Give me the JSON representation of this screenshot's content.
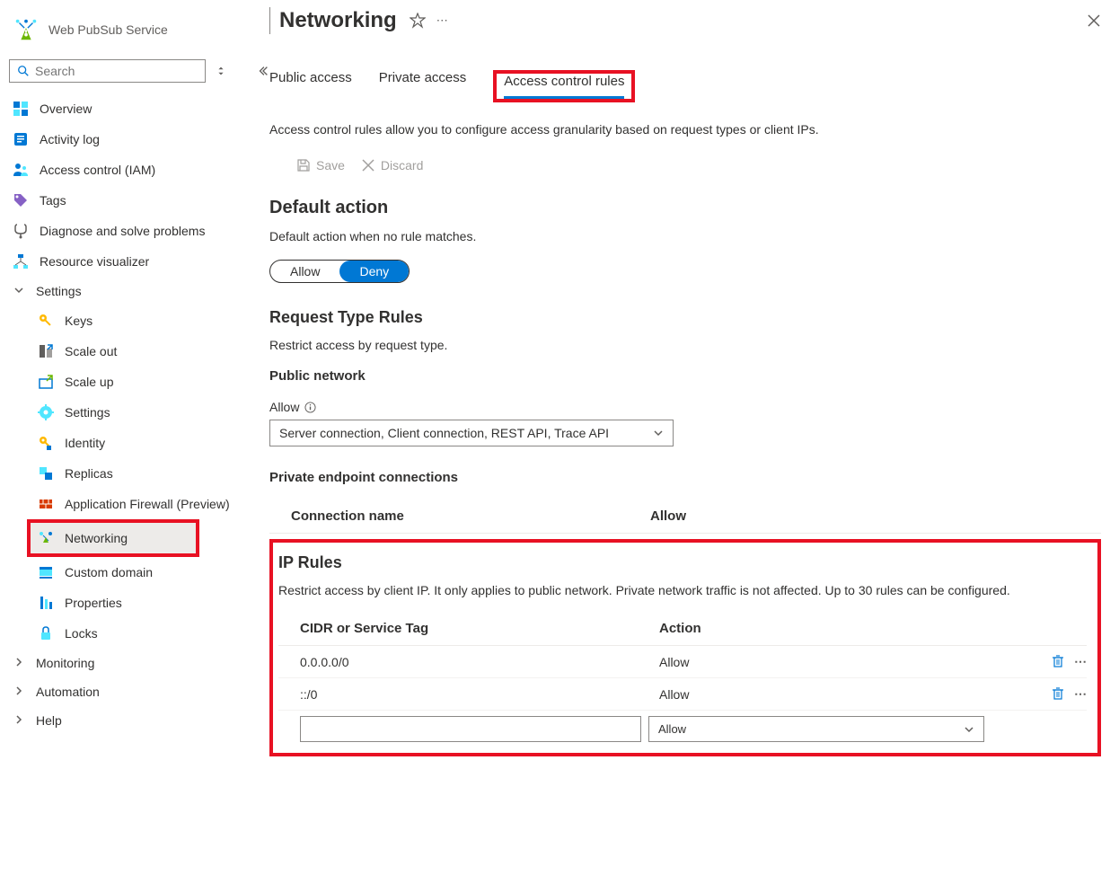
{
  "service_name": "Web PubSub Service",
  "search_placeholder": "Search",
  "nav": {
    "overview": "Overview",
    "activity_log": "Activity log",
    "iam": "Access control (IAM)",
    "tags": "Tags",
    "diagnose": "Diagnose and solve problems",
    "visualizer": "Resource visualizer",
    "settings": "Settings",
    "keys": "Keys",
    "scale_out": "Scale out",
    "scale_up": "Scale up",
    "settings_sub": "Settings",
    "identity": "Identity",
    "replicas": "Replicas",
    "firewall": "Application Firewall (Preview)",
    "networking": "Networking",
    "custom_domain": "Custom domain",
    "properties": "Properties",
    "locks": "Locks",
    "monitoring": "Monitoring",
    "automation": "Automation",
    "help": "Help"
  },
  "page_title": "Networking",
  "tabs": {
    "public": "Public access",
    "private": "Private access",
    "acr": "Access control rules"
  },
  "description": "Access control rules allow you to configure access granularity based on request types or client IPs.",
  "toolbar": {
    "save": "Save",
    "discard": "Discard"
  },
  "default_action": {
    "heading": "Default action",
    "desc": "Default action when no rule matches.",
    "allow": "Allow",
    "deny": "Deny"
  },
  "request_rules": {
    "heading": "Request Type Rules",
    "desc": "Restrict access by request type.",
    "public_network": "Public network",
    "allow_label": "Allow",
    "selected": "Server connection, Client connection, REST API, Trace API",
    "pec_heading": "Private endpoint connections",
    "col_conn": "Connection name",
    "col_allow": "Allow"
  },
  "ip_rules": {
    "heading": "IP Rules",
    "desc": "Restrict access by client IP. It only applies to public network. Private network traffic is not affected. Up to 30 rules can be configured.",
    "col_cidr": "CIDR or Service Tag",
    "col_action": "Action",
    "rows": [
      {
        "cidr": "0.0.0.0/0",
        "action": "Allow"
      },
      {
        "cidr": "::/0",
        "action": "Allow"
      }
    ],
    "new_action": "Allow"
  }
}
